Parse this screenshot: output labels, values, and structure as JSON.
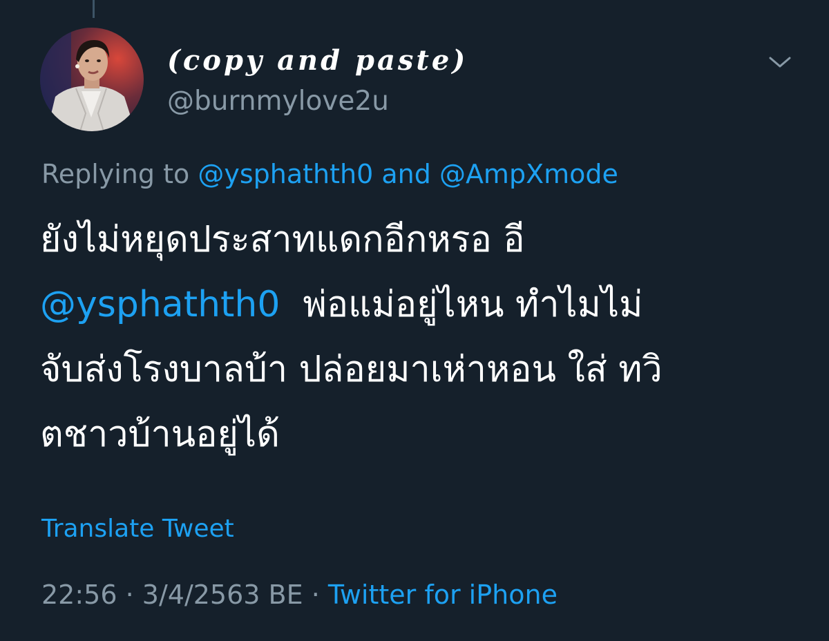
{
  "tweet": {
    "author": {
      "display_name": "(copy and paste)",
      "handle": "@burnmylove2u",
      "avatar_icon": "profile-photo"
    },
    "menu_icon": "chevron-down-icon",
    "reply_context": {
      "prefix": "Replying to",
      "mention_1": "@ysphathth0",
      "joiner": "and",
      "mention_2": "@AmpXmode"
    },
    "body": {
      "line_1": "ยังไม่หยุดประสาทแดกอีกหรอ อี",
      "line_2_mention": "@ysphathth0",
      "line_2_text": "พ่อแม่อยู่ไหน ทำไมไม่",
      "line_3": "จับส่งโรงบาลบ้า ปล่อยมาเห่าหอน ใส่ ทวิ",
      "line_4": "ตชาวบ้านอยู่ได้"
    },
    "translate_label": "Translate Tweet",
    "meta": {
      "time": "22:56",
      "separator": "·",
      "date": "3/4/2563 BE",
      "source": "Twitter for iPhone"
    }
  },
  "colors": {
    "background": "#15202b",
    "text": "#ffffff",
    "secondary": "#8899a6",
    "accent": "#1da1f2"
  }
}
